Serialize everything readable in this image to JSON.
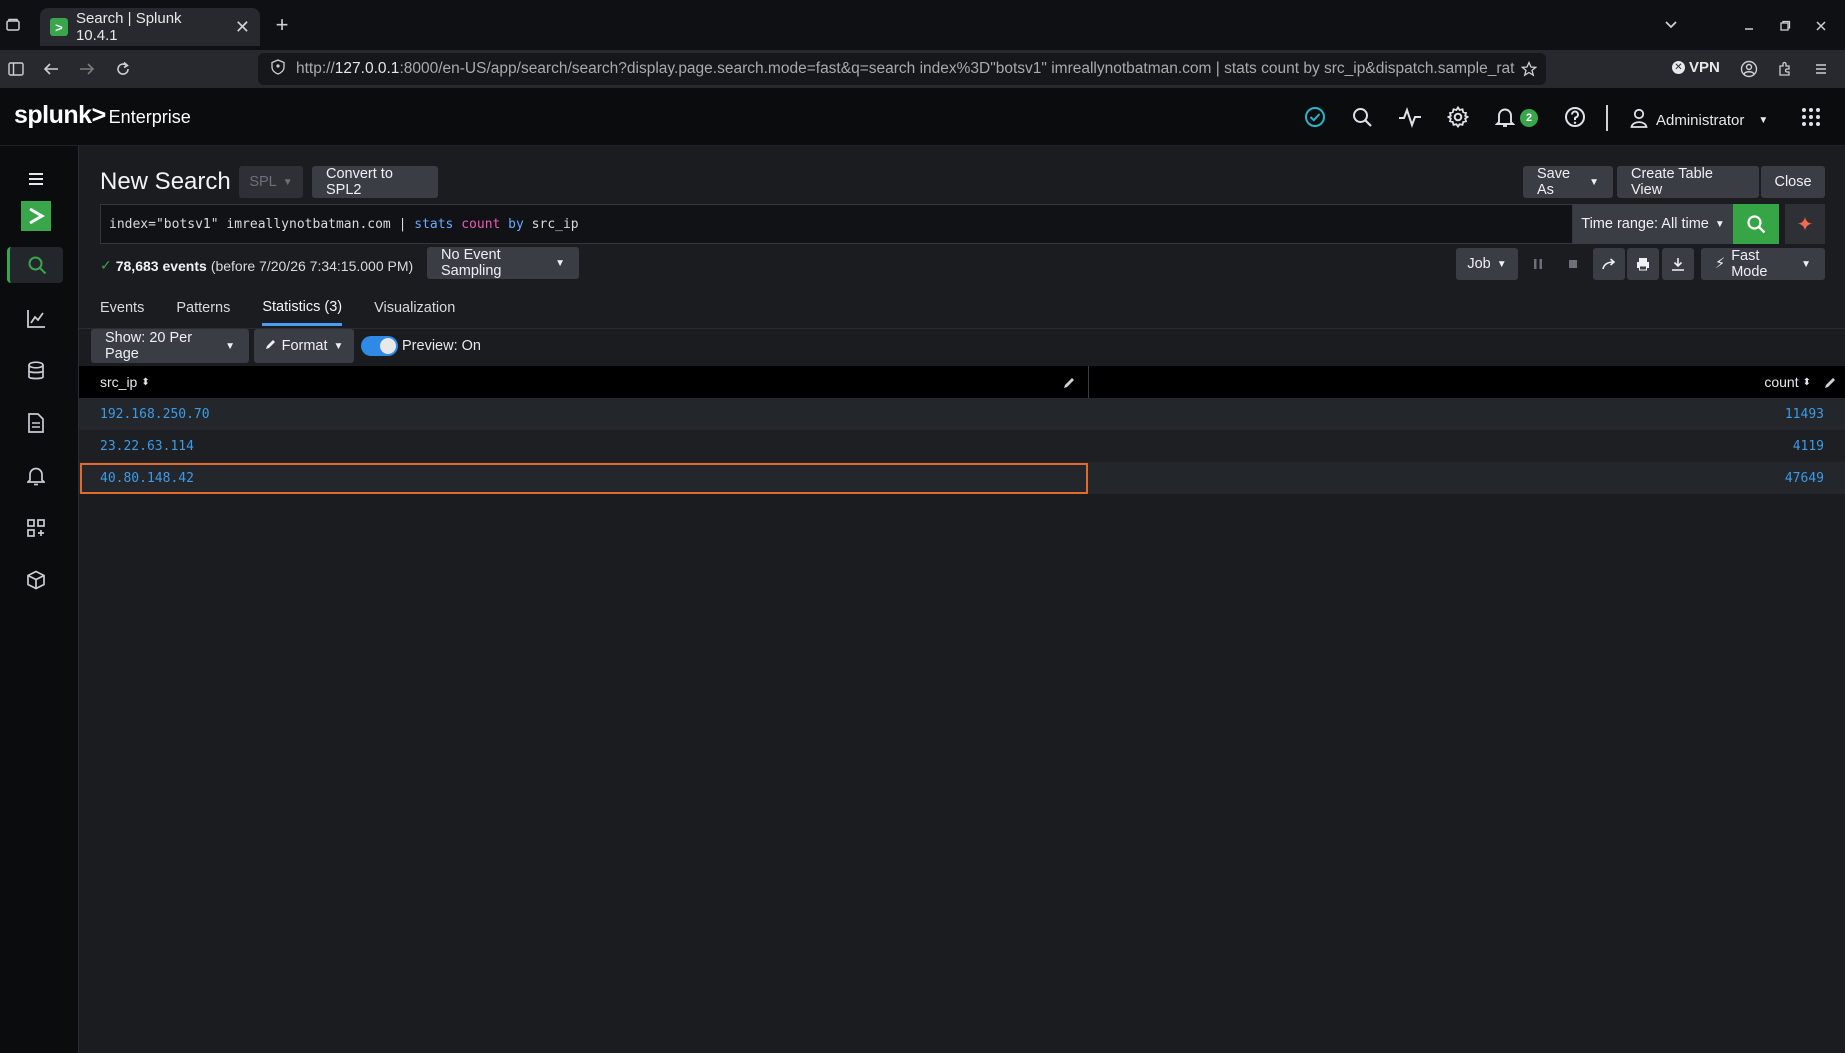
{
  "browser": {
    "tab_title": "Search | Splunk 10.4.1",
    "url_prefix": "http://",
    "url_host": "127.0.0.1",
    "url_rest": ":8000/en-US/app/search/search?display.page.search.mode=fast&q=search index%3D\"botsv1\" imreallynotbatman.com | stats count by src_ip&dispatch.sample_rat",
    "vpn_label": "VPN"
  },
  "header": {
    "brand": "splunk>",
    "product": "Enterprise",
    "notification_count": "2",
    "user": "Administrator"
  },
  "page": {
    "title": "New Search",
    "spl_label": "SPL",
    "convert_label": "Convert to SPL2",
    "save_as_label": "Save As",
    "create_table_label": "Create Table View",
    "close_label": "Close"
  },
  "search": {
    "q_part1": "index=\"botsv1\" imreallynotbatman.com | ",
    "q_cmd": "stats",
    "q_fn": " count",
    "q_kw": " by",
    "q_part2": " src_ip",
    "time_range": "Time range: All time"
  },
  "status": {
    "events": "78,683 events",
    "before": "(before 7/20/26 7:34:15.000 PM)",
    "sampling": "No Event Sampling",
    "job_label": "Job",
    "mode_label": "Fast Mode"
  },
  "tabs": [
    {
      "label": "Events"
    },
    {
      "label": "Patterns"
    },
    {
      "label": "Statistics (3)"
    },
    {
      "label": "Visualization"
    }
  ],
  "toolbar": {
    "show_label": "Show: 20 Per Page",
    "format_label": "Format",
    "preview_label": "Preview: On"
  },
  "table": {
    "columns": [
      "src_ip",
      "count"
    ],
    "rows": [
      {
        "src_ip": "192.168.250.70",
        "count": "11493"
      },
      {
        "src_ip": "23.22.63.114",
        "count": "4119"
      },
      {
        "src_ip": "40.80.148.42",
        "count": "47649"
      }
    ]
  },
  "colors": {
    "accent_green": "#3aa64b",
    "link_blue": "#3c9be6",
    "highlight_orange": "#e26a2c"
  }
}
